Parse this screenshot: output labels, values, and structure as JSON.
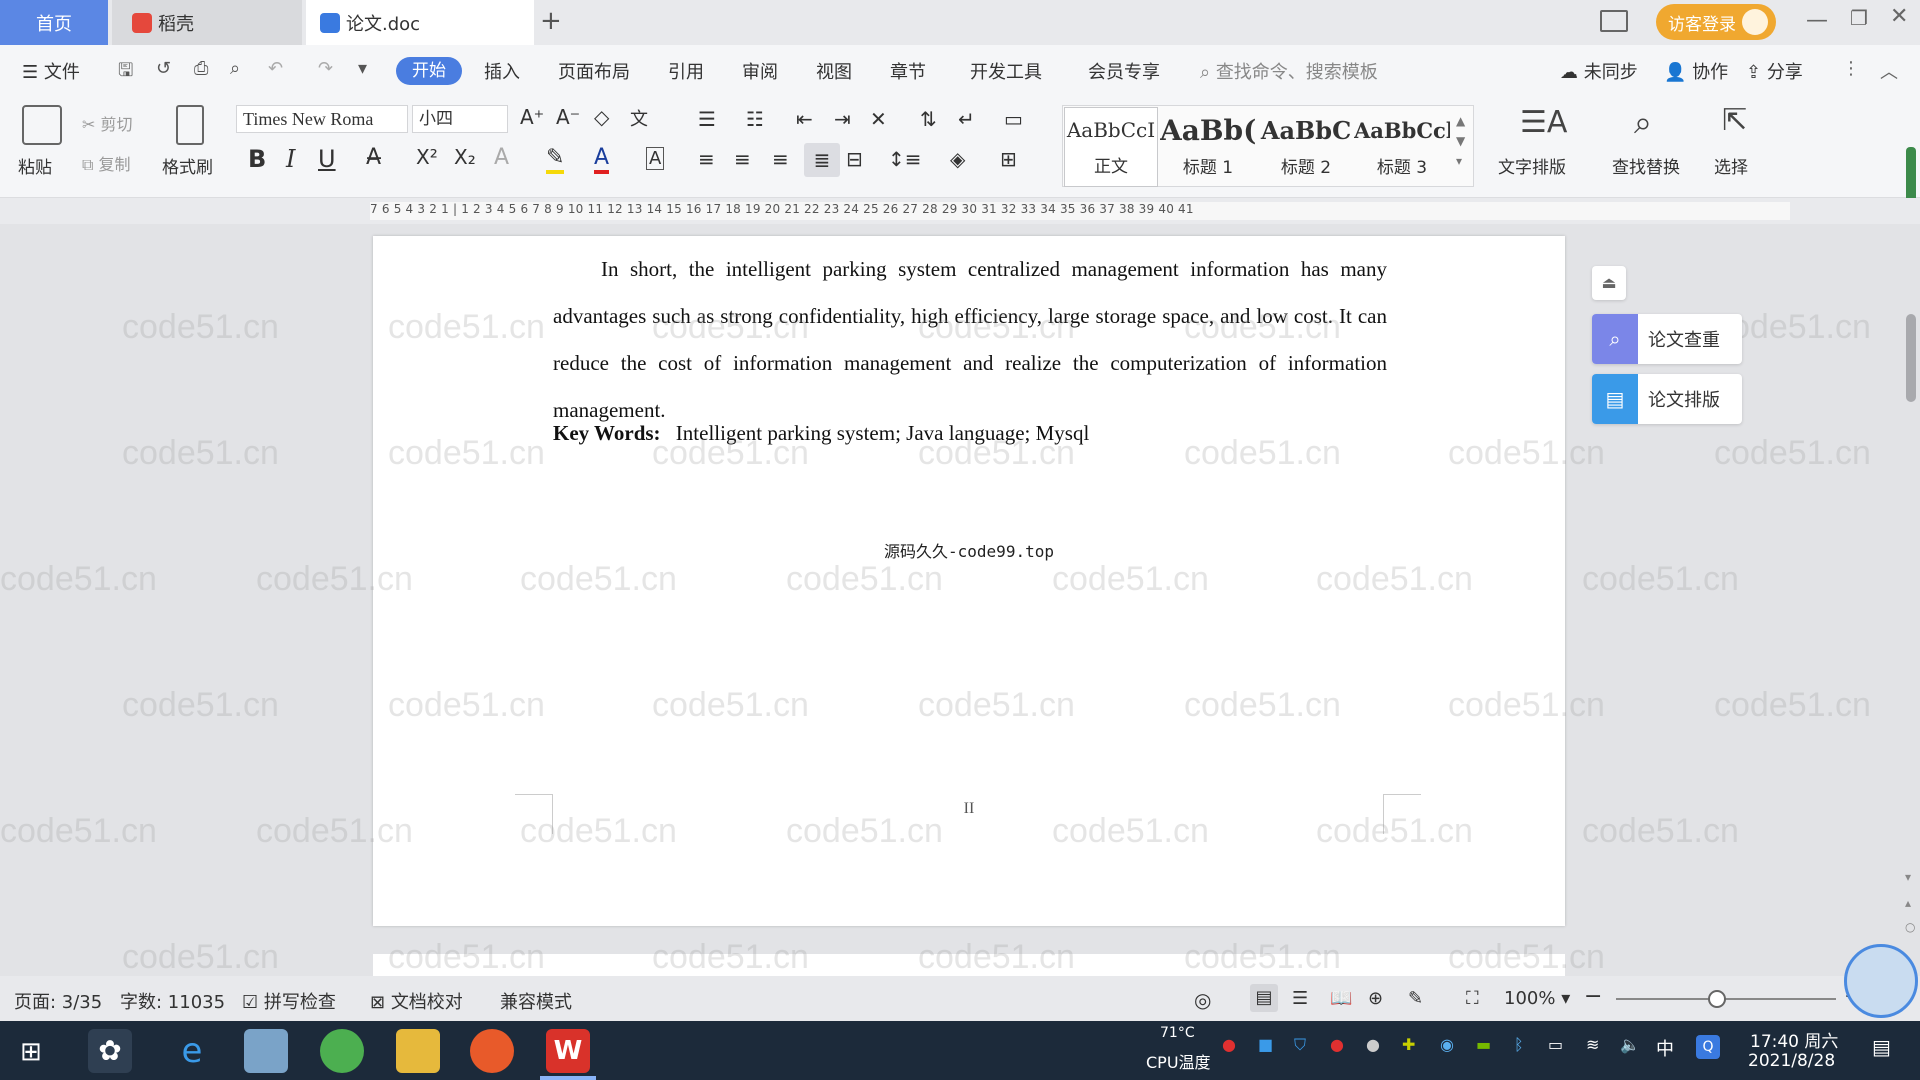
{
  "tabs": {
    "home": "首页",
    "daoke": "稻壳",
    "doc": "论文.doc",
    "new_tab": "+"
  },
  "titlebar": {
    "login": "访客登录"
  },
  "menu": {
    "file": "文件",
    "items": [
      "开始",
      "插入",
      "页面布局",
      "引用",
      "审阅",
      "视图",
      "章节",
      "开发工具",
      "会员专享"
    ],
    "active": "开始",
    "search_placeholder": "查找命令、搜索模板",
    "sync": "未同步",
    "collab": "协作",
    "share": "分享"
  },
  "ribbon": {
    "paste": "粘贴",
    "cut": "剪切",
    "copy": "复制",
    "format_painter": "格式刷",
    "font_name": "Times New Roma",
    "font_size": "小四",
    "styles": [
      {
        "sample": "AaBbCcI",
        "label": "正文"
      },
      {
        "sample": "AaBb(",
        "label": "标题 1"
      },
      {
        "sample": "AaBbC",
        "label": "标题 2"
      },
      {
        "sample": "AaBbCcl",
        "label": "标题 3"
      }
    ],
    "text_layout": "文字排版",
    "find_replace": "查找替换",
    "select": "选择"
  },
  "ruler": {
    "ticks": "7 6 5 4 3 2 1 | 1 2 3 4 5 6 7 8 9 10 11 12 13 14 15 16 17 18 19 20 21 22 23 24 25 26 27 28 29 30 31 32 33 34 35 36 37 38 39 40 41"
  },
  "document": {
    "paragraph": "In short, the intelligent parking system centralized management information has many advantages such as strong confidentiality, high efficiency, large storage space, and low cost. It can reduce the cost of information management and realize the computerization of information management.",
    "keywords_label": "Key Words:",
    "keywords": "Intelligent parking system; Java language; Mysql",
    "source_note": "源码久久-code99.top",
    "page_number": "II",
    "watermark": "code51.cn"
  },
  "side_panel": {
    "check": "论文查重",
    "layout": "论文排版"
  },
  "status": {
    "page": "页面: 3/35",
    "words": "字数: 11035",
    "spellcheck": "拼写检查",
    "proofread": "文档校对",
    "compat": "兼容模式",
    "zoom": "100%"
  },
  "taskbar": {
    "temp": "71°C",
    "cpu": "CPU温度",
    "ime": "中",
    "time": "17:40 周六",
    "date": "2021/8/28"
  },
  "colors": {
    "accent": "#4a7de0",
    "login_bg": "#f0a830"
  }
}
